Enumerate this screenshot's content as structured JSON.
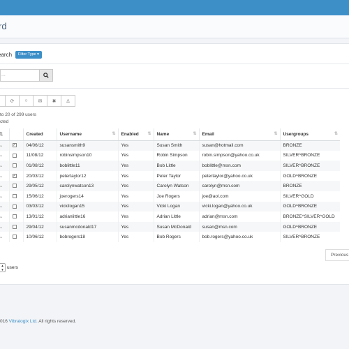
{
  "header": {
    "title": "rd"
  },
  "search": {
    "label": "earch",
    "filter_button": "Filter Type",
    "placeholder": "..."
  },
  "toolbar": {
    "icons": [
      "clock-icon",
      "circle-icon",
      "envelope-icon",
      "close-icon",
      "user-icon"
    ]
  },
  "info": {
    "count": "to 20 of 299 users",
    "selected": "cted"
  },
  "table": {
    "columns": [
      "",
      "",
      "Created",
      "Username",
      "Enabled",
      "Name",
      "Email",
      "Usergroups"
    ],
    "rows": [
      {
        "checked": true,
        "created": "04/06/12",
        "username": "susansmith9",
        "enabled": "Yes",
        "name": "Susan Smith",
        "email": "susan@hotmail.com",
        "usergroups": "BRONZE"
      },
      {
        "checked": false,
        "created": "11/08/12",
        "username": "robinsimpson10",
        "enabled": "Yes",
        "name": "Robin Simpson",
        "email": "robin.simpson@yahoo.co.uk",
        "usergroups": "SILVER^BRONZE"
      },
      {
        "checked": false,
        "created": "01/08/12",
        "username": "boblittle11",
        "enabled": "Yes",
        "name": "Bob Little",
        "email": "boblittle@msn.com",
        "usergroups": "SILVER^BRONZE"
      },
      {
        "checked": true,
        "created": "20/03/12",
        "username": "petertaylor12",
        "enabled": "Yes",
        "name": "Peter Taylor",
        "email": "petertaylor@yahoo.co.uk",
        "usergroups": "GOLD^BRONZE"
      },
      {
        "checked": false,
        "created": "29/05/12",
        "username": "carolynwatson13",
        "enabled": "Yes",
        "name": "Carolyn Watson",
        "email": "carolyn@msn.com",
        "usergroups": "BRONZE"
      },
      {
        "checked": false,
        "created": "15/06/12",
        "username": "joerogers14",
        "enabled": "Yes",
        "name": "Joe Rogers",
        "email": "joe@aol.com",
        "usergroups": "SILVER^GOLD"
      },
      {
        "checked": false,
        "created": "03/03/12",
        "username": "vickilogan15",
        "enabled": "Yes",
        "name": "Vicki Logan",
        "email": "vicki.logan@yahoo.co.uk",
        "usergroups": "GOLD^BRONZE"
      },
      {
        "checked": false,
        "created": "13/01/12",
        "username": "adrianlittle16",
        "enabled": "Yes",
        "name": "Adrian Little",
        "email": "adrian@msn.com",
        "usergroups": "BRONZE^SILVER^GOLD"
      },
      {
        "checked": false,
        "created": "29/04/12",
        "username": "susanmcdonald17",
        "enabled": "Yes",
        "name": "Susan McDonald",
        "email": "susan@msn.com",
        "usergroups": "GOLD^BRONZE"
      },
      {
        "checked": false,
        "created": "10/06/12",
        "username": "bobrogers18",
        "enabled": "Yes",
        "name": "Bob Rogers",
        "email": "bob.rogers@yahoo.co.uk",
        "usergroups": "SILVER^BRONZE"
      }
    ]
  },
  "pagination": {
    "previous": "Previous"
  },
  "pagesize": {
    "suffix": "users"
  },
  "footer": {
    "year": "016",
    "company": "Vibralogix Ltd.",
    "rights": "All rights reserved."
  },
  "colors": {
    "accent": "#3d8fc8"
  }
}
